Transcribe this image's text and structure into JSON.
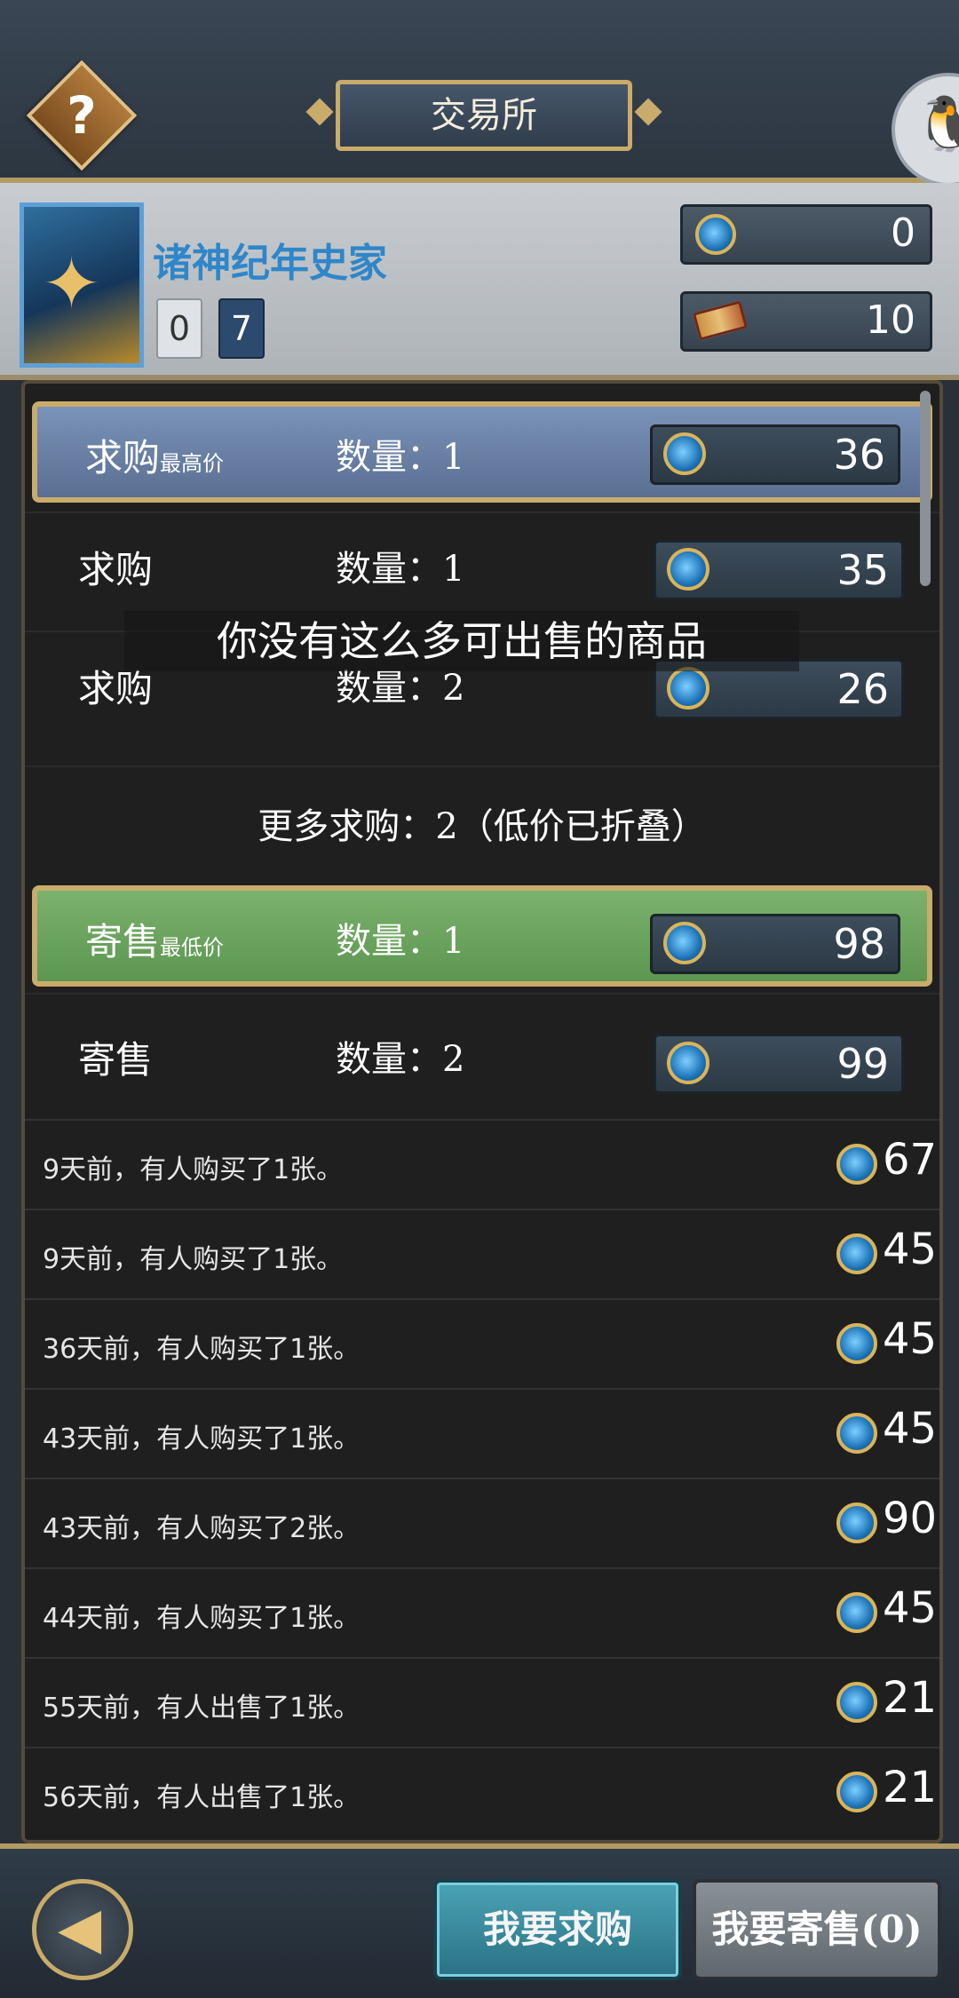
{
  "header": {
    "title": "交易所",
    "help_symbol": "?",
    "qq_symbol": "🐧"
  },
  "profile": {
    "name": "诸神纪年史家",
    "badge_a": "0",
    "badge_b": "7",
    "gold_value": "0",
    "ticket_value": "10"
  },
  "buy_orders": [
    {
      "label": "求购",
      "sub": "最高价",
      "qty": "数量：1",
      "price": "36"
    },
    {
      "label": "求购",
      "qty": "数量：1",
      "price": "35"
    },
    {
      "label": "求购",
      "qty": "数量：2",
      "price": "26"
    }
  ],
  "more_buy": "更多求购：2（低价已折叠）",
  "sell_orders": [
    {
      "label": "寄售",
      "sub": "最低价",
      "qty": "数量：1",
      "price": "98"
    },
    {
      "label": "寄售",
      "qty": "数量：2",
      "price": "99"
    }
  ],
  "history": [
    {
      "text": "9天前，有人购买了1张。",
      "price": "67"
    },
    {
      "text": "9天前，有人购买了1张。",
      "price": "45"
    },
    {
      "text": "36天前，有人购买了1张。",
      "price": "45"
    },
    {
      "text": "43天前，有人购买了1张。",
      "price": "45"
    },
    {
      "text": "43天前，有人购买了2张。",
      "price": "90"
    },
    {
      "text": "44天前，有人购买了1张。",
      "price": "45"
    },
    {
      "text": "55天前，有人出售了1张。",
      "price": "21"
    },
    {
      "text": "56天前，有人出售了1张。",
      "price": "21"
    }
  ],
  "toast": "你没有这么多可出售的商品",
  "footer": {
    "back_symbol": "◀",
    "buy_button": "我要求购",
    "sell_button": "我要寄售(0)"
  },
  "icons": {
    "currency": "gem-icon",
    "ticket": "ticket-icon"
  },
  "colors": {
    "buy_highlight": "#6a82a8",
    "sell_highlight": "#6ba45f",
    "gold_border": "#c9ab6a"
  }
}
